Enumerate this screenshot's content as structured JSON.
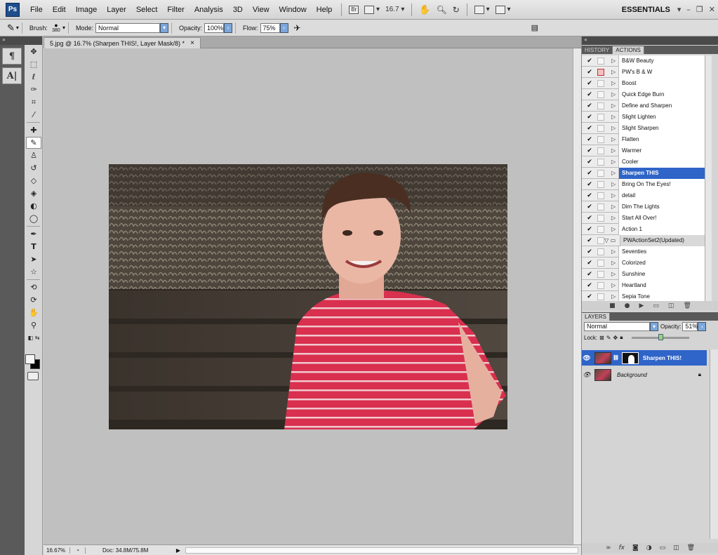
{
  "app": {
    "logo": "Ps"
  },
  "menu": [
    "File",
    "Edit",
    "Image",
    "Layer",
    "Select",
    "Filter",
    "Analysis",
    "3D",
    "View",
    "Window",
    "Help"
  ],
  "menubar_extra": {
    "bridge": "Br",
    "zoom": "16.7",
    "workspace": "ESSENTIALS"
  },
  "options": {
    "brush_label": "Brush:",
    "brush_size": "380",
    "mode_label": "Mode:",
    "mode_value": "Normal",
    "opacity_label": "Opacity:",
    "opacity_value": "100%",
    "flow_label": "Flow:",
    "flow_value": "75%"
  },
  "document": {
    "tab_title": "5.jpg @ 16.7% (Sharpen THIS!, Layer Mask/8) *",
    "close": "×"
  },
  "status": {
    "zoom": "16.67%",
    "doc": "Doc: 34.8M/75.8M"
  },
  "panels": {
    "history_tab": "HISTORY",
    "actions_tab": "ACTIONS",
    "layers_tab": "LAYERS"
  },
  "actions": [
    {
      "name": "B&W Beauty",
      "checked": true,
      "dialog": false,
      "set": false
    },
    {
      "name": "PW's B & W",
      "checked": true,
      "dialog": true,
      "set": false
    },
    {
      "name": "Boost",
      "checked": true,
      "dialog": false,
      "set": false
    },
    {
      "name": "Quick Edge Burn",
      "checked": true,
      "dialog": false,
      "set": false
    },
    {
      "name": "Define and Sharpen",
      "checked": true,
      "dialog": false,
      "set": false
    },
    {
      "name": "Slight Lighten",
      "checked": true,
      "dialog": false,
      "set": false
    },
    {
      "name": "Slight Sharpen",
      "checked": true,
      "dialog": false,
      "set": false
    },
    {
      "name": "Flatten",
      "checked": true,
      "dialog": false,
      "set": false
    },
    {
      "name": "Warmer",
      "checked": true,
      "dialog": false,
      "set": false
    },
    {
      "name": "Cooler",
      "checked": true,
      "dialog": false,
      "set": false
    },
    {
      "name": "Sharpen THIS",
      "checked": true,
      "dialog": false,
      "set": false,
      "selected": true
    },
    {
      "name": "Bring On The Eyes!",
      "checked": true,
      "dialog": false,
      "set": false
    },
    {
      "name": "detail",
      "checked": true,
      "dialog": false,
      "set": false
    },
    {
      "name": "Dim The Lights",
      "checked": true,
      "dialog": false,
      "set": false
    },
    {
      "name": "Start All Over!",
      "checked": true,
      "dialog": false,
      "set": false
    },
    {
      "name": "Action 1",
      "checked": true,
      "dialog": false,
      "set": false
    },
    {
      "name": "PWActionSet2(Updated)",
      "checked": true,
      "dialog": false,
      "set": true
    },
    {
      "name": "Seventies",
      "checked": true,
      "dialog": false,
      "set": false
    },
    {
      "name": "Colorized",
      "checked": true,
      "dialog": false,
      "set": false
    },
    {
      "name": "Sunshine",
      "checked": true,
      "dialog": false,
      "set": false
    },
    {
      "name": "Heartland",
      "checked": true,
      "dialog": false,
      "set": false
    },
    {
      "name": "Sepia Tone",
      "checked": true,
      "dialog": false,
      "set": false
    }
  ],
  "layers_panel": {
    "blend_mode": "Normal",
    "opacity_label": "Opacity:",
    "opacity_value": "51%",
    "lock_label": "Lock:",
    "opacity_fraction": 0.51
  },
  "layers": [
    {
      "name": "Sharpen THIS!",
      "selected": true,
      "has_mask": true
    },
    {
      "name": "Background",
      "selected": false,
      "has_mask": false,
      "locked": true
    }
  ],
  "colors": {
    "selection": "#2f64c8",
    "accent": "#1f4e8c"
  }
}
